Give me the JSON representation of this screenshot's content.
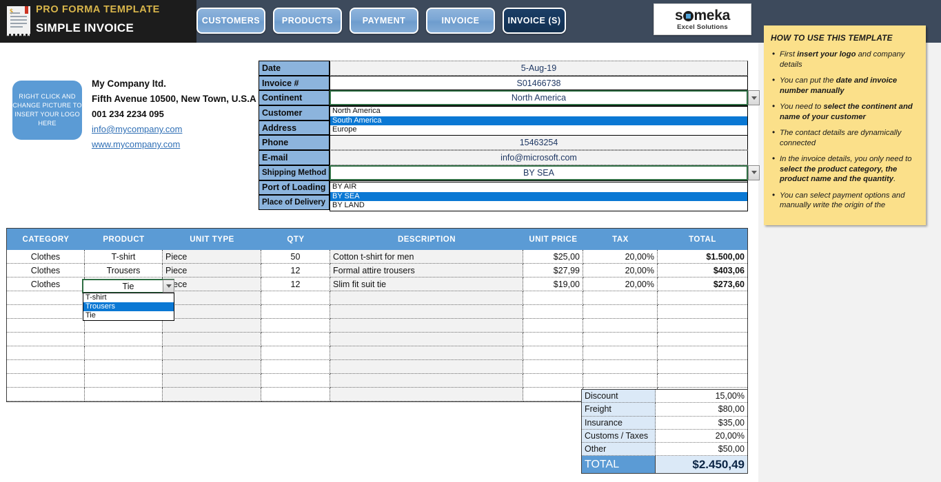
{
  "header": {
    "sub_title": "PRO FORMA TEMPLATE",
    "main_title": "SIMPLE INVOICE",
    "nav": [
      {
        "label": "CUSTOMERS",
        "active": false
      },
      {
        "label": "PRODUCTS",
        "active": false
      },
      {
        "label": "PAYMENT",
        "active": false
      },
      {
        "label": "INVOICE",
        "active": false
      },
      {
        "label": "INVOICE (S)",
        "active": true
      }
    ],
    "logo": {
      "name": "someka",
      "tagline": "Excel Solutions"
    }
  },
  "logo_placeholder": "RIGHT CLICK AND CHANGE PICTURE TO INSERT YOUR LOGO HERE",
  "company": {
    "name": "My Company ltd.",
    "address": "Fifth Avenue 10500, New Town, U.S.A",
    "phone": "001 234 2234 095",
    "email": "info@mycompany.com",
    "website": "www.mycompany.com"
  },
  "form": {
    "rows": [
      {
        "label": "Date",
        "value": "5-Aug-19",
        "style": "grey"
      },
      {
        "label": "Invoice #",
        "value": "S01466738",
        "style": "white"
      },
      {
        "label": "Continent",
        "value": "North America",
        "style": "selected",
        "dropdown": true
      },
      {
        "label": "Customer",
        "value": "",
        "style": "white"
      },
      {
        "label": "Address",
        "value": "",
        "style": "white"
      },
      {
        "label": "Phone",
        "value": "15463254",
        "style": "grey"
      },
      {
        "label": "E-mail",
        "value": "info@microsoft.com",
        "style": "grey"
      },
      {
        "label": "Shipping Method",
        "value": "BY SEA",
        "style": "selected",
        "dropdown": true
      },
      {
        "label": "Port of Loading",
        "value": "",
        "style": "white"
      },
      {
        "label": "Place of Delivery",
        "value": "",
        "style": "white"
      }
    ],
    "continent_options": [
      "North America",
      "South America",
      "Europe"
    ],
    "continent_highlighted": "South America",
    "shipping_options": [
      "BY AIR",
      "BY SEA",
      "BY LAND"
    ],
    "shipping_highlighted": "BY SEA"
  },
  "table": {
    "columns": [
      "CATEGORY",
      "PRODUCT",
      "UNIT TYPE",
      "QTY",
      "DESCRIPTION",
      "UNIT PRICE",
      "TAX",
      "TOTAL"
    ],
    "rows": [
      {
        "category": "Clothes",
        "product": "T-shirt",
        "unit": "Piece",
        "qty": "50",
        "description": "Cotton t-shirt for men",
        "price": "$25,00",
        "tax": "20,00%",
        "total": "$1.500,00"
      },
      {
        "category": "Clothes",
        "product": "Trousers",
        "unit": "Piece",
        "qty": "12",
        "description": "Formal attire trousers",
        "price": "$27,99",
        "tax": "20,00%",
        "total": "$403,06"
      },
      {
        "category": "Clothes",
        "product": "Tie",
        "unit": "Piece",
        "qty": "12",
        "description": "Slim fit suit tie",
        "price": "$19,00",
        "tax": "20,00%",
        "total": "$273,60"
      }
    ],
    "empty_row_count": 8,
    "product_cell_selected_value": "Tie",
    "product_options": [
      "T-shirt",
      "Trousers",
      "Tie"
    ],
    "product_highlighted": "Trousers"
  },
  "totals": {
    "rows": [
      {
        "label": "Discount",
        "value": "15,00%"
      },
      {
        "label": "Freight",
        "value": "$80,00"
      },
      {
        "label": "Insurance",
        "value": "$35,00"
      },
      {
        "label": "Customs / Taxes",
        "value": "20,00%"
      },
      {
        "label": "Other",
        "value": "$50,00"
      }
    ],
    "grand_label": "TOTAL",
    "grand_value": "$2.450,49"
  },
  "help": {
    "title": "HOW TO USE THIS TEMPLATE",
    "items": [
      "First <b>insert your logo</b> and company details",
      "You can put the <b>date and invoice number manually</b>",
      "You need to <b>select the continent and name of your customer</b>",
      "The contact details are dynamically connected",
      "In the invoice details, you only need to <b>select the product category, the product name and the quantity</b>.",
      "You can select payment options and manually write the origin of the"
    ]
  },
  "colors": {
    "header_dark": "#3d4a5c",
    "header_black": "#1c1c1c",
    "gold": "#d9b64b",
    "accent_blue": "#5b9bd5",
    "label_blue": "#8cb4dd",
    "select_green": "#2f6e43",
    "highlight_blue": "#0a78d4",
    "help_yellow": "#fbe08a",
    "link_blue": "#2f6fb5"
  }
}
